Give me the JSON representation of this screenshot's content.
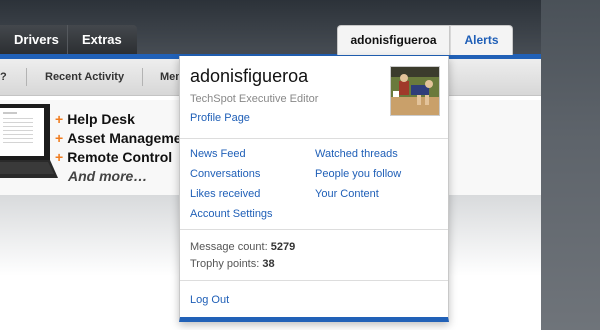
{
  "nav": {
    "tabs": [
      {
        "label": "Drivers"
      },
      {
        "label": "Extras"
      }
    ],
    "account_tab": "adonisfigueroa",
    "alerts_tab": "Alerts"
  },
  "subnav": {
    "items": [
      {
        "label": "?"
      },
      {
        "label": "Recent Activity"
      },
      {
        "label": "Mem"
      }
    ]
  },
  "features": {
    "items": [
      {
        "label": "Help Desk"
      },
      {
        "label": "Asset Management"
      },
      {
        "label": "Remote Control"
      }
    ],
    "more": "And more…"
  },
  "popup": {
    "username": "adonisfigueroa",
    "user_title": "TechSpot Executive Editor",
    "profile_link": "Profile Page",
    "links_left": [
      {
        "label": "News Feed"
      },
      {
        "label": "Conversations"
      },
      {
        "label": "Likes received"
      },
      {
        "label": "Account Settings"
      }
    ],
    "links_right": [
      {
        "label": "Watched threads"
      },
      {
        "label": "People you follow"
      },
      {
        "label": "Your Content"
      }
    ],
    "stats": {
      "message_label": "Message count:",
      "message_value": "5279",
      "trophy_label": "Trophy points:",
      "trophy_value": "38"
    },
    "logout": "Log Out"
  },
  "colors": {
    "accent": "#2161b7",
    "link": "#1f5fb7",
    "feature_plus": "#f07c1f"
  }
}
